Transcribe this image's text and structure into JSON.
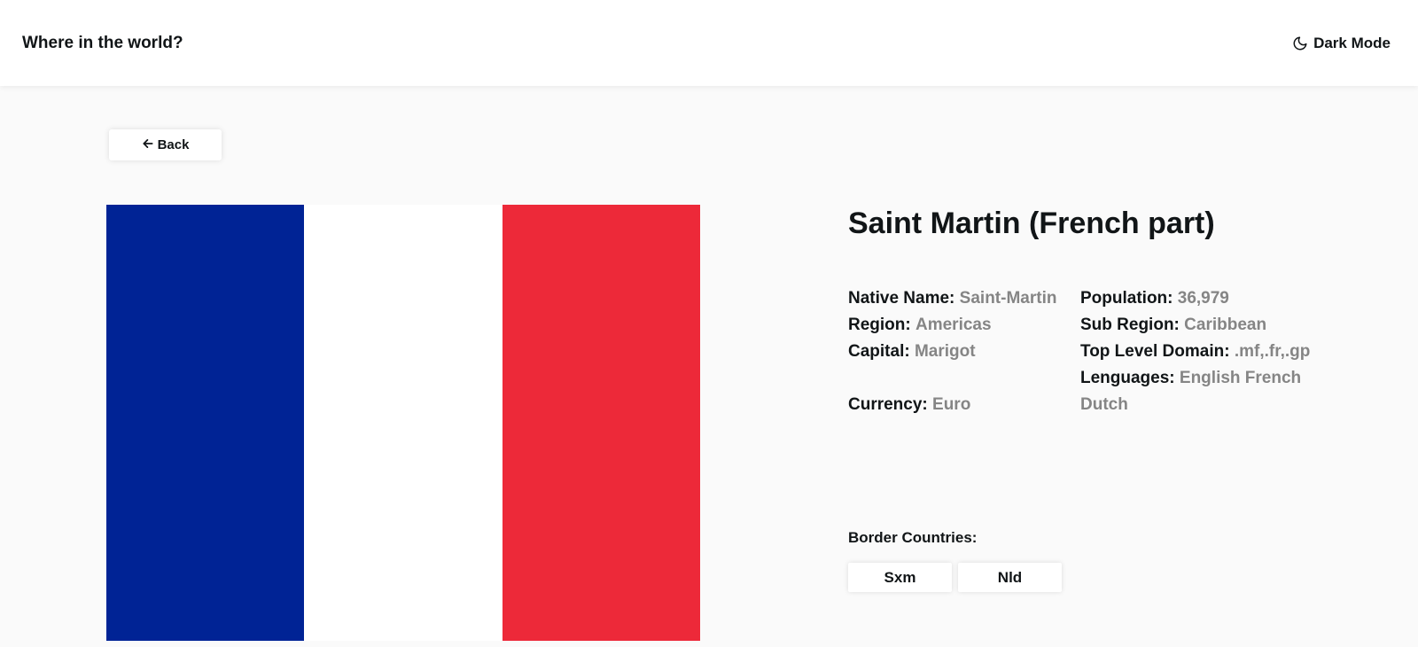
{
  "header": {
    "title": "Where in the world?",
    "dark_mode_label": "Dark Mode",
    "dark_mode_icon": "moon-icon"
  },
  "back_button": {
    "label": "Back",
    "icon": "arrow-left-icon"
  },
  "country": {
    "name": "Saint Martin (French part)",
    "flag_colors": [
      "#002395",
      "#ffffff",
      "#ed2939"
    ],
    "left_details": [
      {
        "label": "Native Name:",
        "value": "Saint-Martin"
      },
      {
        "label": "Region:",
        "value": "Americas"
      },
      {
        "label": "Capital:",
        "value": "Marigot"
      },
      {
        "label": "Currency:",
        "value": "Euro"
      }
    ],
    "right_details": [
      {
        "label": "Population:",
        "value": "36,979"
      },
      {
        "label": "Sub Region:",
        "value": "Caribbean"
      },
      {
        "label": "Top Level Domain:",
        "value": ".mf,.fr,.gp"
      },
      {
        "label": "Lenguages:",
        "value": "English French Dutch"
      }
    ]
  },
  "borders": {
    "label": "Border Countries:",
    "items": [
      "Sxm",
      "Nld"
    ]
  }
}
